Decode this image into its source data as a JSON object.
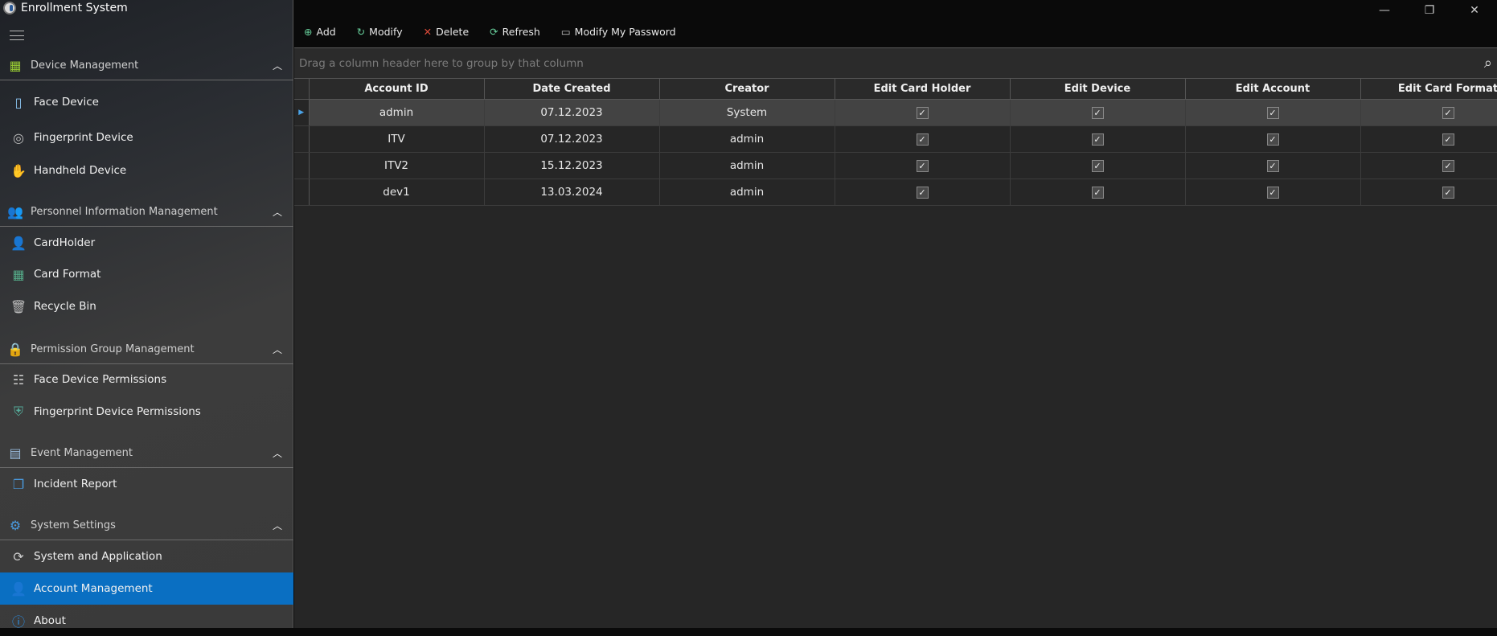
{
  "app": {
    "title": "Enrollment System"
  },
  "window": {
    "minimize": "—",
    "restore": "❐",
    "close": "✕"
  },
  "sidebar": {
    "sections": [
      {
        "label": "Device Management",
        "items": [
          "Face Device",
          "Fingerprint Device",
          "Handheld Device"
        ]
      },
      {
        "label": "Personnel Information Management",
        "items": [
          "CardHolder",
          "Card Format",
          "Recycle Bin"
        ]
      },
      {
        "label": "Permission Group Management",
        "items": [
          "Face Device Permissions",
          "Fingerprint Device Permissions"
        ]
      },
      {
        "label": "Event Management",
        "items": [
          "Incident Report"
        ]
      },
      {
        "label": "System Settings",
        "items": [
          "System and Application",
          "Account Management",
          "About"
        ]
      }
    ],
    "selected": "Account Management"
  },
  "toolbar": {
    "add": "Add",
    "modify": "Modify",
    "delete": "Delete",
    "refresh": "Refresh",
    "modify_password": "Modify My Password"
  },
  "grid": {
    "group_hint": "Drag a column header here to group by that column",
    "columns": [
      "Account ID",
      "Date Created",
      "Creator",
      "Edit Card Holder",
      "Edit Device",
      "Edit Account",
      "Edit Card Format"
    ],
    "rows": [
      {
        "id": "admin",
        "date": "07.12.2023",
        "creator": "System",
        "perms": [
          true,
          true,
          true,
          true
        ]
      },
      {
        "id": "ITV",
        "date": "07.12.2023",
        "creator": "admin",
        "perms": [
          true,
          true,
          true,
          true
        ]
      },
      {
        "id": "ITV2",
        "date": "15.12.2023",
        "creator": "admin",
        "perms": [
          true,
          true,
          true,
          true
        ]
      },
      {
        "id": "dev1",
        "date": "13.03.2024",
        "creator": "admin",
        "perms": [
          true,
          true,
          true,
          true
        ]
      }
    ]
  },
  "colors": {
    "accent": "#0a6fc2"
  }
}
